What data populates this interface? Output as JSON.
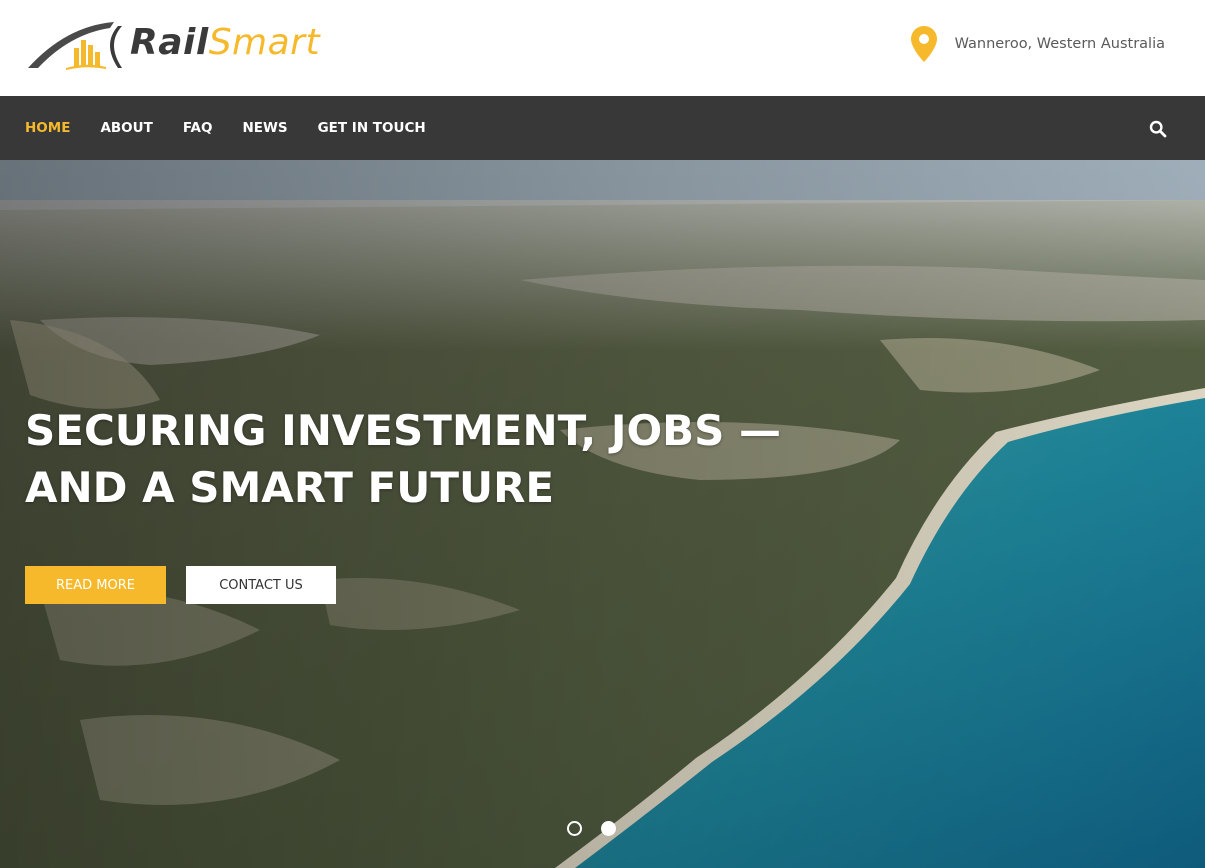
{
  "brand": {
    "logo_rail": "Rail",
    "logo_smart": "Smart",
    "accent_color": "#f6b92b"
  },
  "header": {
    "location_icon": "map-pin-icon",
    "location": "Wanneroo, Western Australia"
  },
  "nav": {
    "items": [
      {
        "label": "HOME",
        "active": true
      },
      {
        "label": "ABOUT",
        "active": false
      },
      {
        "label": "FAQ",
        "active": false
      },
      {
        "label": "NEWS",
        "active": false
      },
      {
        "label": "GET IN TOUCH",
        "active": false
      }
    ],
    "search_icon": "search-icon",
    "background": "#383838"
  },
  "hero": {
    "title_line1": "SECURING INVESTMENT, JOBS —",
    "title_line2": "AND A SMART FUTURE",
    "primary_button": "READ MORE",
    "secondary_button": "CONTACT US",
    "slides": {
      "count": 2,
      "active_index": 1
    }
  }
}
